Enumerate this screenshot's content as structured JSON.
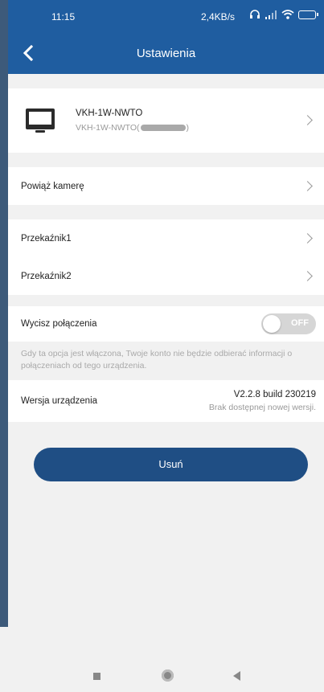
{
  "status_bar": {
    "time": "11:15",
    "network_speed": "2,4KB/s",
    "battery": "84"
  },
  "header": {
    "title": "Ustawienia"
  },
  "device": {
    "name": "VKH-1W-NWTO",
    "id_prefix": "VKH-1W-NWTO(",
    "id_suffix": ")"
  },
  "rows": {
    "bind_camera": "Powiąż kamerę",
    "relay1": "Przekaźnik1",
    "relay2": "Przekaźnik2",
    "mute_calls": "Wycisz połączenia"
  },
  "mute_toggle": {
    "state_label": "OFF"
  },
  "mute_hint": "Gdy ta opcja jest włączona, Twoje konto nie będzie odbierać informacji o połączeniach od tego urządzenia.",
  "version": {
    "label": "Wersja urządzenia",
    "number": "V2.2.8 build 230219",
    "note": "Brak dostępnej nowej wersji."
  },
  "delete_label": "Usuń",
  "colors": {
    "primary": "#1f5da0",
    "button": "#1f4e84",
    "background": "#f1f1f1"
  }
}
